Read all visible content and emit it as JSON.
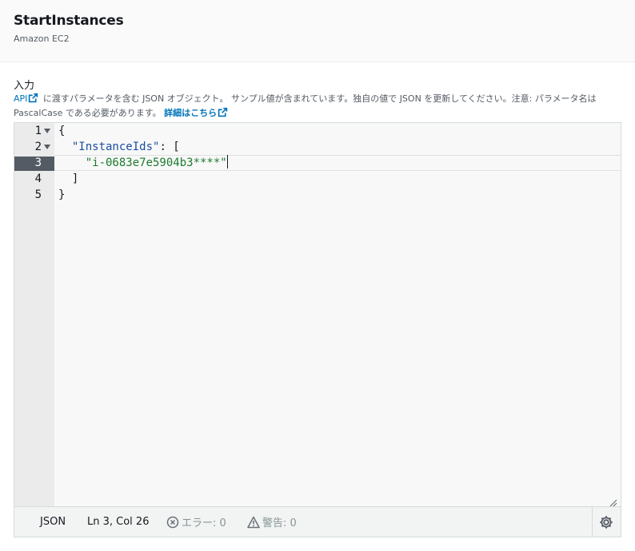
{
  "header": {
    "title": "StartInstances",
    "subtitle": "Amazon EC2"
  },
  "input_section": {
    "label": "入力",
    "api_link": "API",
    "description_part1": "に渡すパラメータを含む JSON オブジェクト。 サンプル値が含まれています。独自の値で JSON を更新してください。注意: パラメータ名は PascalCase である必要があります。",
    "details_link": "詳細はこちら"
  },
  "editor": {
    "line_numbers": [
      "1",
      "2",
      "3",
      "4",
      "5"
    ],
    "lines": [
      {
        "indent": "",
        "parts": [
          {
            "t": "{",
            "c": "punc"
          }
        ]
      },
      {
        "indent": "  ",
        "parts": [
          {
            "t": "\"InstanceIds\"",
            "c": "key"
          },
          {
            "t": ": [",
            "c": "punc"
          }
        ]
      },
      {
        "indent": "    ",
        "parts": [
          {
            "t": "\"i-0683e7e5904b3****\"",
            "c": "str"
          }
        ]
      },
      {
        "indent": "  ",
        "parts": [
          {
            "t": "]",
            "c": "punc"
          }
        ]
      },
      {
        "indent": "",
        "parts": [
          {
            "t": "}",
            "c": "punc"
          }
        ]
      }
    ],
    "active_line": 3,
    "foldable_lines": [
      1,
      2
    ]
  },
  "statusbar": {
    "mode": "JSON",
    "position": "Ln 3, Col 26",
    "errors": "エラー: 0",
    "warnings": "警告: 0"
  },
  "colors": {
    "link": "#0073bb",
    "key": "#1a4fa0",
    "string": "#1d7a2e",
    "active_gutter": "#545b64"
  }
}
